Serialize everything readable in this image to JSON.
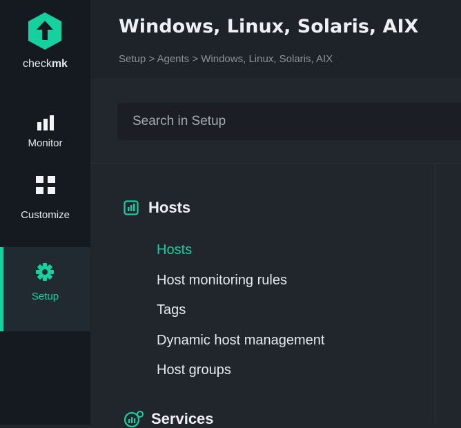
{
  "sidebar": {
    "logo_text_regular": "check",
    "logo_text_bold": "mk",
    "items": [
      {
        "label": "Monitor",
        "icon": "monitor-bars-icon"
      },
      {
        "label": "Customize",
        "icon": "grid-icon"
      },
      {
        "label": "Setup",
        "icon": "gear-icon",
        "active": true
      }
    ]
  },
  "header": {
    "title": "Windows, Linux, Solaris, AIX",
    "breadcrumb": "Setup > Agents > Windows, Linux, Solaris, AIX"
  },
  "search": {
    "placeholder": "Search in Setup",
    "value": ""
  },
  "sections": [
    {
      "title": "Hosts",
      "icon": "hosts-icon",
      "items": [
        "Hosts",
        "Host monitoring rules",
        "Tags",
        "Dynamic host management",
        "Host groups"
      ],
      "active_item": "Hosts"
    },
    {
      "title": "Services",
      "icon": "services-icon"
    }
  ],
  "colors": {
    "accent": "#15d1a0",
    "sidebar_bg": "#151a20",
    "main_bg": "#21252c",
    "header_bg": "#1e2229"
  }
}
